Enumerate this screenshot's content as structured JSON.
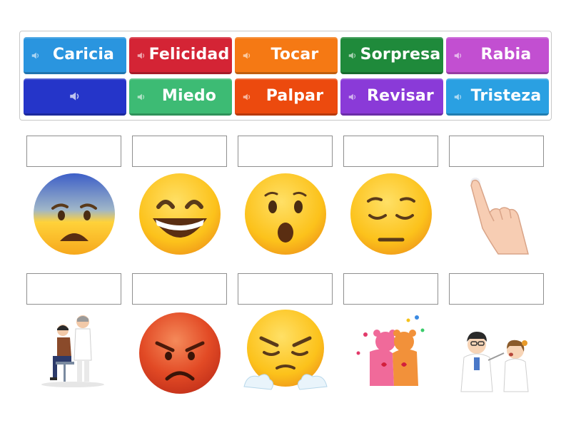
{
  "word_bank": [
    {
      "label": "Caricia",
      "color": "#2a95df",
      "icon": "speaker-icon"
    },
    {
      "label": "Felicidad",
      "color": "#d42435",
      "icon": "speaker-icon"
    },
    {
      "label": "Tocar",
      "color": "#f57914",
      "icon": "speaker-icon"
    },
    {
      "label": "Sorpresa",
      "color": "#1f8a3b",
      "icon": "speaker-icon"
    },
    {
      "label": "Rabia",
      "color": "#c24fd1",
      "icon": "speaker-icon"
    },
    {
      "label": "",
      "color": "#2535c9",
      "icon": "speaker-icon"
    },
    {
      "label": "Miedo",
      "color": "#3dbb74",
      "icon": "speaker-icon"
    },
    {
      "label": "Palpar",
      "color": "#ec4a0e",
      "icon": "speaker-icon"
    },
    {
      "label": "Revisar",
      "color": "#8a3ad8",
      "icon": "speaker-icon"
    },
    {
      "label": "Tristeza",
      "color": "#2aa0e2",
      "icon": "speaker-icon"
    }
  ],
  "pictures": [
    {
      "name": "fearful-face-image"
    },
    {
      "name": "grinning-face-image"
    },
    {
      "name": "surprised-face-image"
    },
    {
      "name": "sad-face-image"
    },
    {
      "name": "pointing-finger-image"
    },
    {
      "name": "doctor-examining-patient-image"
    },
    {
      "name": "angry-face-image"
    },
    {
      "name": "steam-nose-face-image"
    },
    {
      "name": "hugging-bears-image"
    },
    {
      "name": "doctor-checking-throat-image"
    }
  ]
}
